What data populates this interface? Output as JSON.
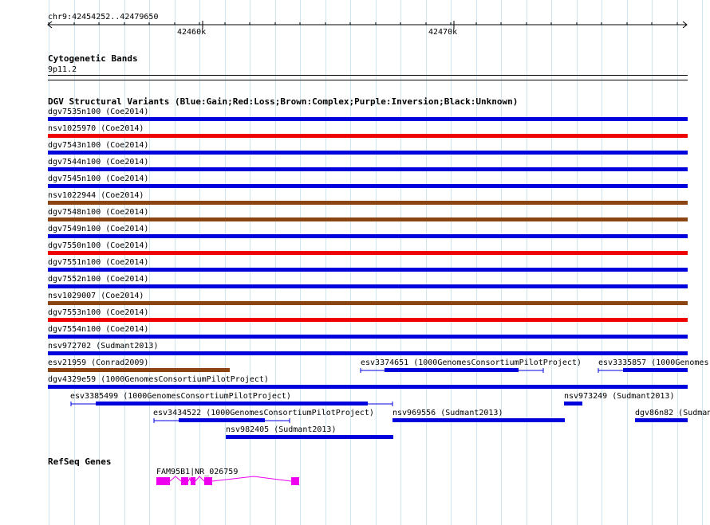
{
  "ruler": {
    "coordinate_label": "chr9:42454252..42479650",
    "tick_labels": [
      "42460k",
      "42470k"
    ]
  },
  "cytoband": {
    "title": "Cytogenetic Bands",
    "band": "9p11.2"
  },
  "dgv": {
    "title": "DGV Structural Variants (Blue:Gain;Red:Loss;Brown:Complex;Purple:Inversion;Black:Unknown)",
    "colors": {
      "gain": "#0000dd",
      "loss": "#ee0000",
      "complex": "#8b4513"
    },
    "features": [
      {
        "label": "dgv7535n100 (Coe2014)",
        "type": "gain"
      },
      {
        "label": "nsv1025970 (Coe2014)",
        "type": "loss"
      },
      {
        "label": "dgv7543n100 (Coe2014)",
        "type": "gain"
      },
      {
        "label": "dgv7544n100 (Coe2014)",
        "type": "gain"
      },
      {
        "label": "dgv7545n100 (Coe2014)",
        "type": "gain"
      },
      {
        "label": "nsv1022944 (Coe2014)",
        "type": "complex"
      },
      {
        "label": "dgv7548n100 (Coe2014)",
        "type": "complex"
      },
      {
        "label": "dgv7549n100 (Coe2014)",
        "type": "gain"
      },
      {
        "label": "dgv7550n100 (Coe2014)",
        "type": "loss"
      },
      {
        "label": "dgv7551n100 (Coe2014)",
        "type": "gain"
      },
      {
        "label": "dgv7552n100 (Coe2014)",
        "type": "gain"
      },
      {
        "label": "nsv1029007 (Coe2014)",
        "type": "complex"
      },
      {
        "label": "dgv7553n100 (Coe2014)",
        "type": "loss"
      },
      {
        "label": "dgv7554n100 (Coe2014)",
        "type": "gain"
      },
      {
        "label": "nsv972702 (Sudmant2013)",
        "type": "gain"
      }
    ],
    "partial": {
      "esv21959": "esv21959 (Conrad2009)",
      "esv3374651": "esv3374651 (1000GenomesConsortiumPilotProject)",
      "esv3335857": "esv3335857 (1000Genomes",
      "dgv4329e59": "dgv4329e59 (1000GenomesConsortiumPilotProject)",
      "esv3385499": "esv3385499 (1000GenomesConsortiumPilotProject)",
      "nsv973249": "nsv973249 (Sudmant2013)",
      "esv3434522": "esv3434522 (1000GenomesConsortiumPilotProject)",
      "nsv969556": "nsv969556 (Sudmant2013)",
      "dgv86n82": "dgv86n82 (Sudman",
      "nsv982405": "nsv982405 (Sudmant2013)"
    }
  },
  "refseq": {
    "title": "RefSeq Genes",
    "gene_label": "FAM95B1|NR_026759",
    "color": "#ee00ee"
  }
}
